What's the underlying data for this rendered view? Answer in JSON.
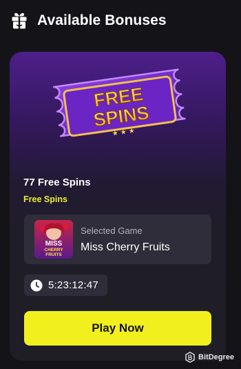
{
  "header": {
    "title": "Available Bonuses",
    "icon": "gift-icon"
  },
  "card": {
    "banner": {
      "line1": "FREE",
      "line2": "SPINS",
      "stars": "★ ★ ★"
    },
    "bonus_title": "77 Free Spins",
    "bonus_type": "Free Spins",
    "game": {
      "label": "Selected Game",
      "name": "Miss Cherry Fruits",
      "thumb_line1": "MISS",
      "thumb_line2": "CHERRY",
      "thumb_line3": "FRUITS"
    },
    "timer": {
      "value": "5:23:12:47",
      "icon": "clock-icon"
    },
    "play_label": "Play Now"
  },
  "watermark": {
    "text": "BitDegree"
  },
  "colors": {
    "background": "#141318",
    "accent_yellow": "#f1f01e",
    "bonus_type_yellow": "#e9f02f",
    "panel": "#2f2d39",
    "card_purple": "#4d1f8a"
  }
}
